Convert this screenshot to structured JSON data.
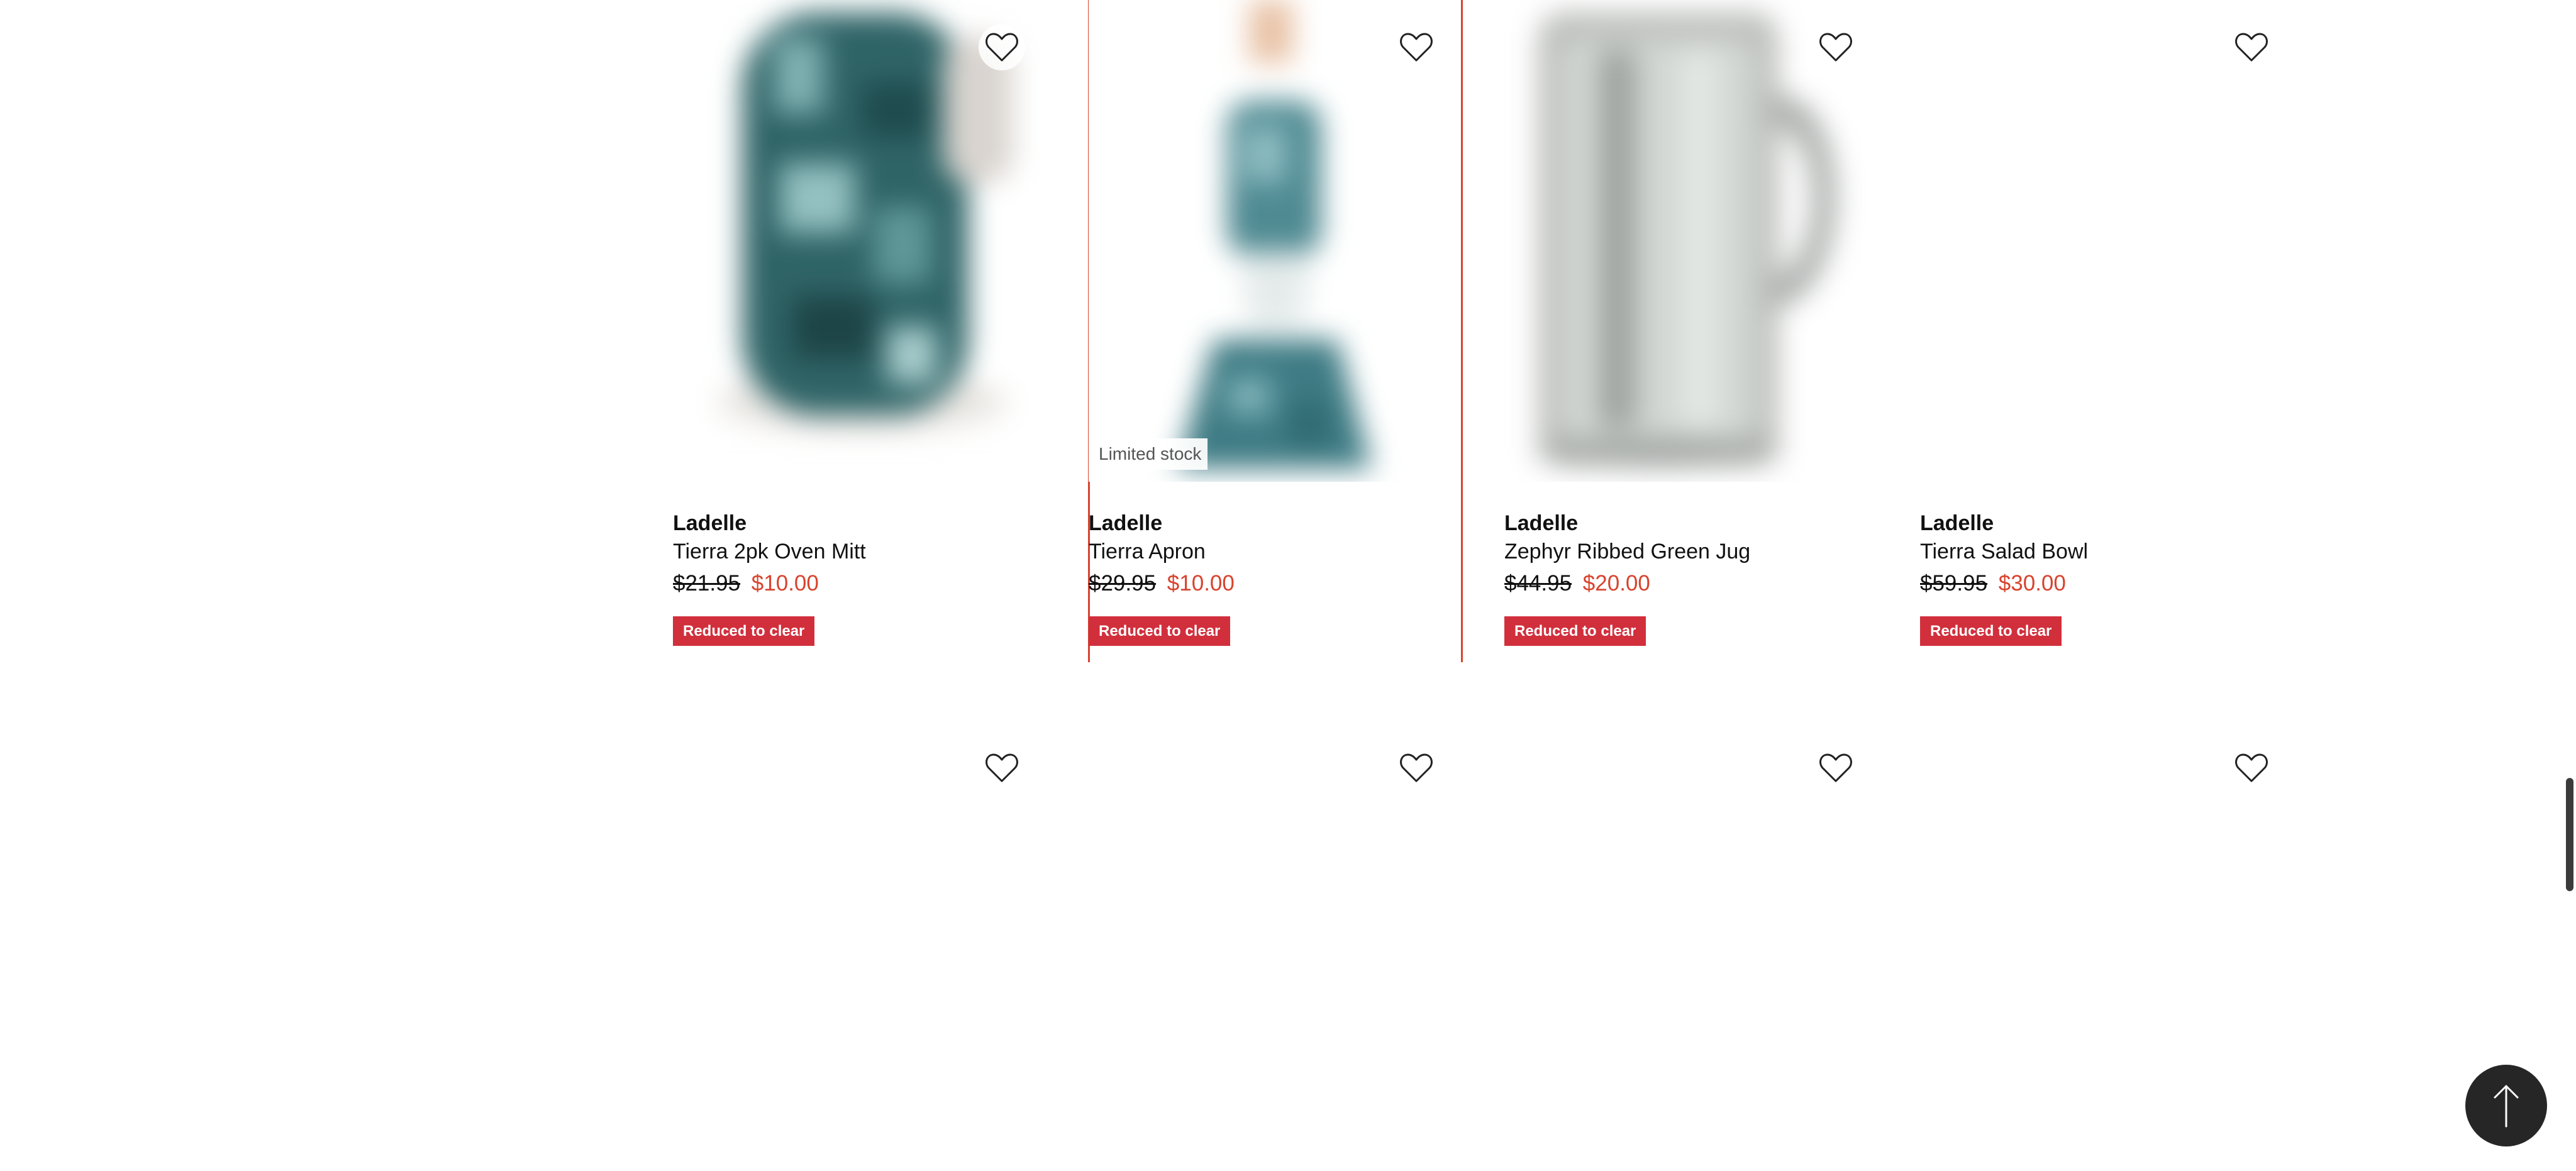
{
  "colors": {
    "sale_price": "#d8432e",
    "promo_badge": "#d12f3c",
    "highlight_border": "#d8432e",
    "back_to_top": "#262626"
  },
  "products": [
    {
      "brand": "Ladelle",
      "name": "Tierra 2pk Oven Mitt",
      "was_price": "$21.95",
      "now_price": "$10.00",
      "promo": "Reduced to clear",
      "stock_badge": null,
      "wishlist_icon": "heart-outline-icon"
    },
    {
      "brand": "Ladelle",
      "name": "Tierra Apron",
      "was_price": "$29.95",
      "now_price": "$10.00",
      "promo": "Reduced to clear",
      "stock_badge": "Limited stock",
      "wishlist_icon": "heart-outline-icon"
    },
    {
      "brand": "Ladelle",
      "name": "Zephyr Ribbed Green Jug",
      "was_price": "$44.95",
      "now_price": "$20.00",
      "promo": "Reduced to clear",
      "stock_badge": null,
      "wishlist_icon": "heart-outline-icon"
    },
    {
      "brand": "Ladelle",
      "name": "Tierra Salad Bowl",
      "was_price": "$59.95",
      "now_price": "$30.00",
      "promo": "Reduced to clear",
      "stock_badge": null,
      "wishlist_icon": "heart-outline-icon"
    }
  ],
  "back_to_top_icon": "arrow-up-icon"
}
